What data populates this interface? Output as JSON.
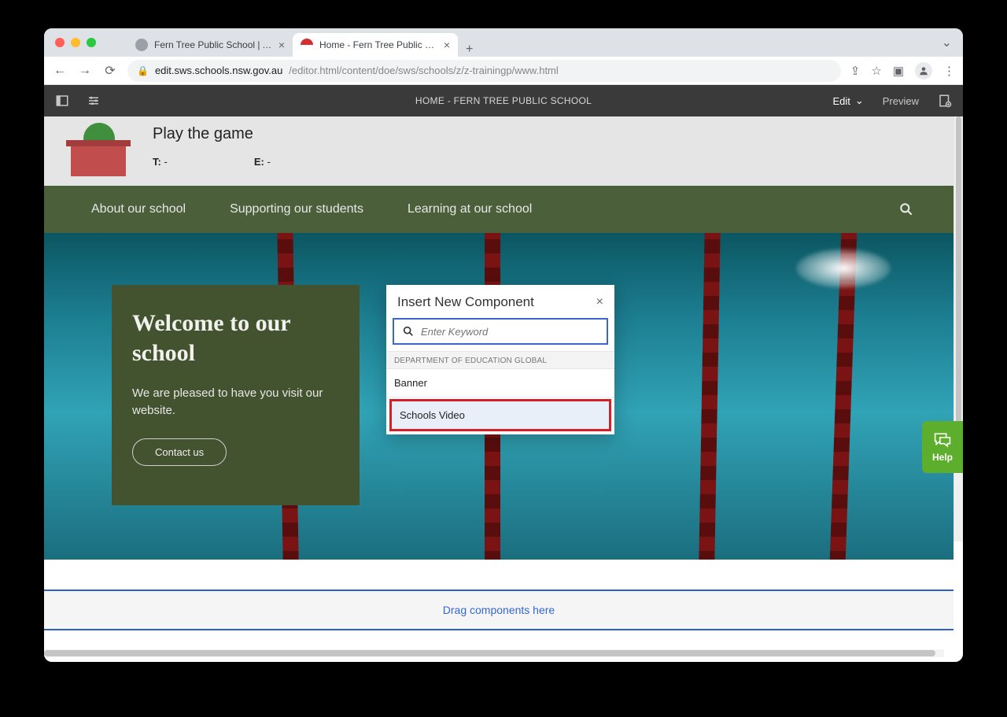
{
  "browser": {
    "tabs": [
      {
        "label": "Fern Tree Public School | AEM"
      },
      {
        "label": "Home - Fern Tree Public School"
      }
    ],
    "url_host": "edit.sws.schools.nsw.gov.au",
    "url_path": "/editor.html/content/doe/sws/schools/z/z-trainingp/www.html"
  },
  "aem": {
    "title": "HOME - FERN TREE PUBLIC SCHOOL",
    "mode": "Edit",
    "preview": "Preview"
  },
  "school_header": {
    "tagline": "Play the game",
    "t_label": "T:",
    "t_value": "-",
    "e_label": "E:",
    "e_value": "-"
  },
  "nav": {
    "items": [
      "About our school",
      "Supporting our students",
      "Learning at our school"
    ]
  },
  "hero": {
    "heading": "Welcome to our school",
    "body": "We are pleased to have you visit our website.",
    "cta": "Contact us"
  },
  "dropzone": "Drag components here",
  "dialog": {
    "title": "Insert New Component",
    "search_placeholder": "Enter Keyword",
    "group_label": "DEPARTMENT OF EDUCATION GLOBAL",
    "items": [
      "Banner",
      "Schools Video"
    ]
  },
  "help": {
    "label": "Help"
  }
}
